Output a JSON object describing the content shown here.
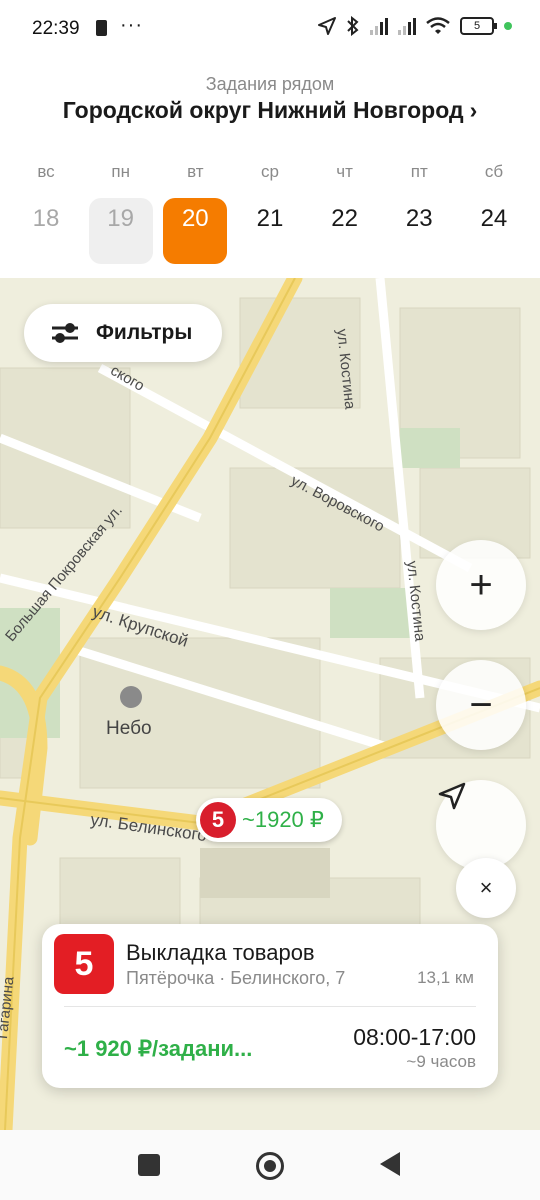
{
  "status_bar": {
    "time": "22:39",
    "more": "···",
    "battery": "5"
  },
  "header": {
    "subtitle": "Задания рядом",
    "title": "Городской округ Нижний Новгород",
    "chevron": "›"
  },
  "week": {
    "days": [
      {
        "name": "вс",
        "date": "18"
      },
      {
        "name": "пн",
        "date": "19"
      },
      {
        "name": "вт",
        "date": "20"
      },
      {
        "name": "ср",
        "date": "21"
      },
      {
        "name": "чт",
        "date": "22"
      },
      {
        "name": "пт",
        "date": "23"
      },
      {
        "name": "сб",
        "date": "24"
      }
    ],
    "selected_color": "#f57c00"
  },
  "map": {
    "filter_label": "Фильтры",
    "streets": {
      "kostina_top": "ул. Костина",
      "vorovskogo": "ул. Воровского",
      "kostina_mid": "ул. Костина",
      "pokrovskaya": "Большая Покровская ул.",
      "krupskoy": "ул. Крупской",
      "belinskogo": "ул. Белинского",
      "gagarina": "Гагарина",
      "kogo": "ского"
    },
    "poi_label": "Небо",
    "pin_price": "~1920 ₽",
    "zoom_in": "+",
    "zoom_out": "−",
    "close": "×"
  },
  "card": {
    "logo_text": "5",
    "title": "Выкладка товаров",
    "store": "Пятёрочка · Белинского, 7",
    "distance": "13,1 км",
    "payment": "~1 920 ₽/задани...",
    "time": "08:00-17:00",
    "duration": "~9 часов"
  },
  "colors": {
    "accent": "#f57c00",
    "price_green": "#2fb048",
    "brand_red": "#e31e24"
  }
}
